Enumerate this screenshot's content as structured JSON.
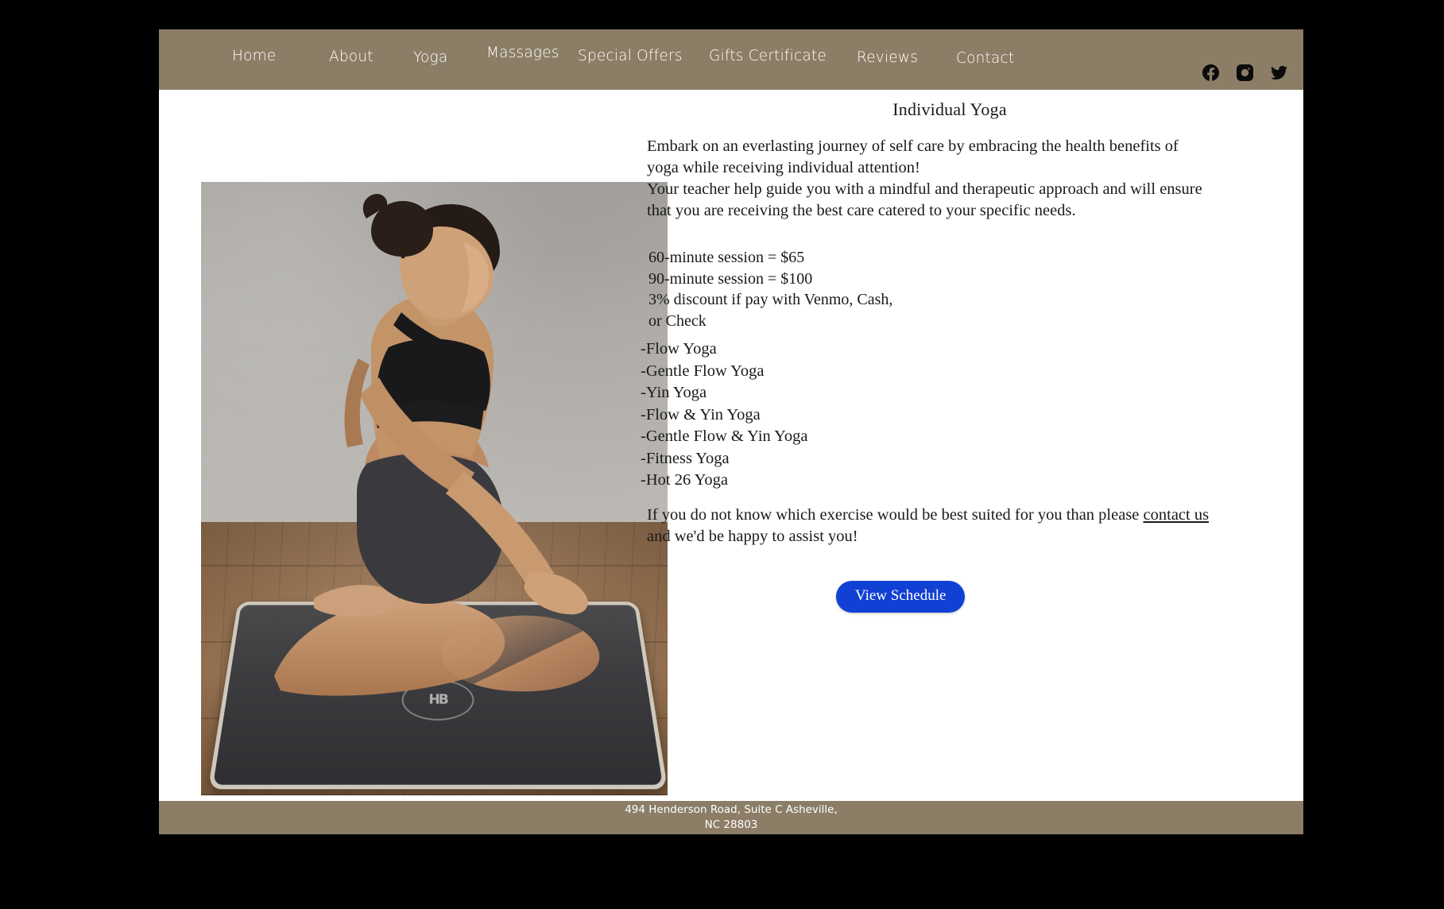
{
  "header": {
    "background_color": "#8b7d66",
    "nav_items": [
      {
        "label": "Home"
      },
      {
        "label": "About"
      },
      {
        "label": "Yoga"
      },
      {
        "label": "Massages"
      },
      {
        "label": "Special Offers"
      },
      {
        "label": "Gifts Certificate"
      },
      {
        "label": "Reviews"
      },
      {
        "label": "Contact"
      }
    ],
    "social": [
      {
        "name": "facebook-icon"
      },
      {
        "name": "instagram-icon"
      },
      {
        "name": "twitter-icon"
      }
    ]
  },
  "main": {
    "photo": {
      "alt": "Woman seated cross-legged in meditation pose on a yoga mat on a wooden floor"
    },
    "title": "Individual Yoga",
    "intro_line_1": "Embark on an everlasting journey of self care by embracing the health benefits of yoga while receiving individual attention!",
    "intro_line_2": "Your teacher help guide you with a mindful and therapeutic approach and will ensure that you are receiving the best care catered to your specific needs.",
    "pricing": [
      "60-minute session = $65",
      "90-minute session = $100",
      "3% discount if pay with Venmo, Cash,",
      "or Check"
    ],
    "yoga_types": [
      "-Flow Yoga",
      "-Gentle Flow Yoga",
      "-Yin Yoga",
      "-Flow & Yin Yoga",
      "-Gentle Flow & Yin Yoga",
      "-Fitness Yoga",
      "-Hot 26 Yoga"
    ],
    "closing_before_link": "If you do not know which exercise would be best suited for you than please ",
    "closing_link": "contact us",
    "closing_after_link": " and we'd be happy to assist you!",
    "cta_label": "View Schedule",
    "cta_color": "#1141d4"
  },
  "footer": {
    "address_line_1": "494 Henderson Road, Suite C Asheville,",
    "address_line_2": "NC 28803",
    "background_color": "#8b7d66"
  }
}
